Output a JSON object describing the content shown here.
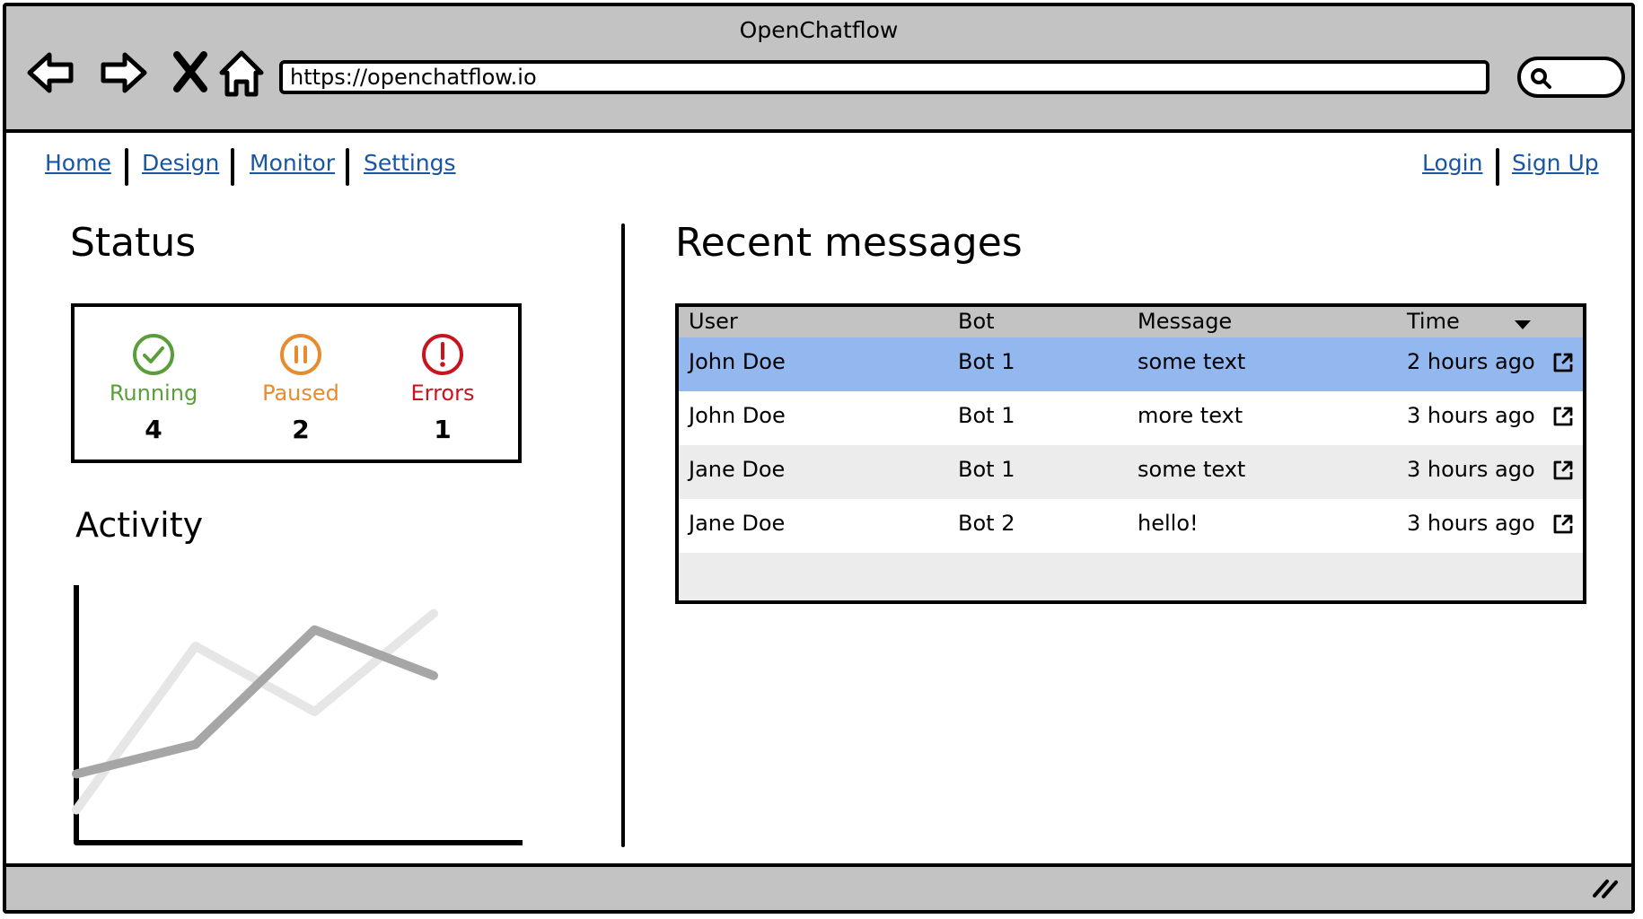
{
  "browser": {
    "title": "OpenChatflow",
    "url": "https://openchatflow.io",
    "icons": [
      "back-arrow-icon",
      "forward-arrow-icon",
      "close-x-icon",
      "home-icon",
      "search-icon"
    ]
  },
  "nav": {
    "left": [
      "Home",
      "Design",
      "Monitor",
      "Settings"
    ],
    "right": [
      "Login",
      "Sign Up"
    ]
  },
  "status": {
    "heading": "Status",
    "items": [
      {
        "label": "Running",
        "count": "4",
        "color": "#5a9e3a",
        "icon": "check-circle-icon"
      },
      {
        "label": "Paused",
        "count": "2",
        "color": "#e88a2e",
        "icon": "pause-circle-icon"
      },
      {
        "label": "Errors",
        "count": "1",
        "color": "#c8141e",
        "icon": "exclamation-circle-icon"
      }
    ]
  },
  "activity": {
    "heading": "Activity"
  },
  "messages": {
    "heading": "Recent messages",
    "columns": [
      "User",
      "Bot",
      "Message",
      "Time"
    ],
    "selected_row": 0,
    "colors": {
      "selected": "#93b8ef",
      "stripe": "#ececec",
      "plain": "#ffffff"
    },
    "rows": [
      {
        "user": "John Doe",
        "bot": "Bot 1",
        "message": "some text",
        "time": "2 hours ago"
      },
      {
        "user": "John Doe",
        "bot": "Bot 1",
        "message": "more text",
        "time": "3 hours ago"
      },
      {
        "user": "Jane Doe",
        "bot": "Bot 1",
        "message": "some text",
        "time": "3 hours ago"
      },
      {
        "user": "Jane Doe",
        "bot": "Bot 2",
        "message": "hello!",
        "time": "3 hours ago"
      }
    ]
  },
  "chart_data": {
    "type": "line",
    "x": [
      0,
      1,
      2,
      3
    ],
    "series": [
      {
        "values": [
          1,
          6,
          4,
          7
        ],
        "color": "#e6e6e6"
      },
      {
        "values": [
          2.1,
          3,
          6.5,
          5.1
        ],
        "color": "#a6a6a6"
      }
    ],
    "ylim": [
      0,
      8
    ],
    "grid": false,
    "title": "",
    "xlabel": "",
    "ylabel": ""
  }
}
